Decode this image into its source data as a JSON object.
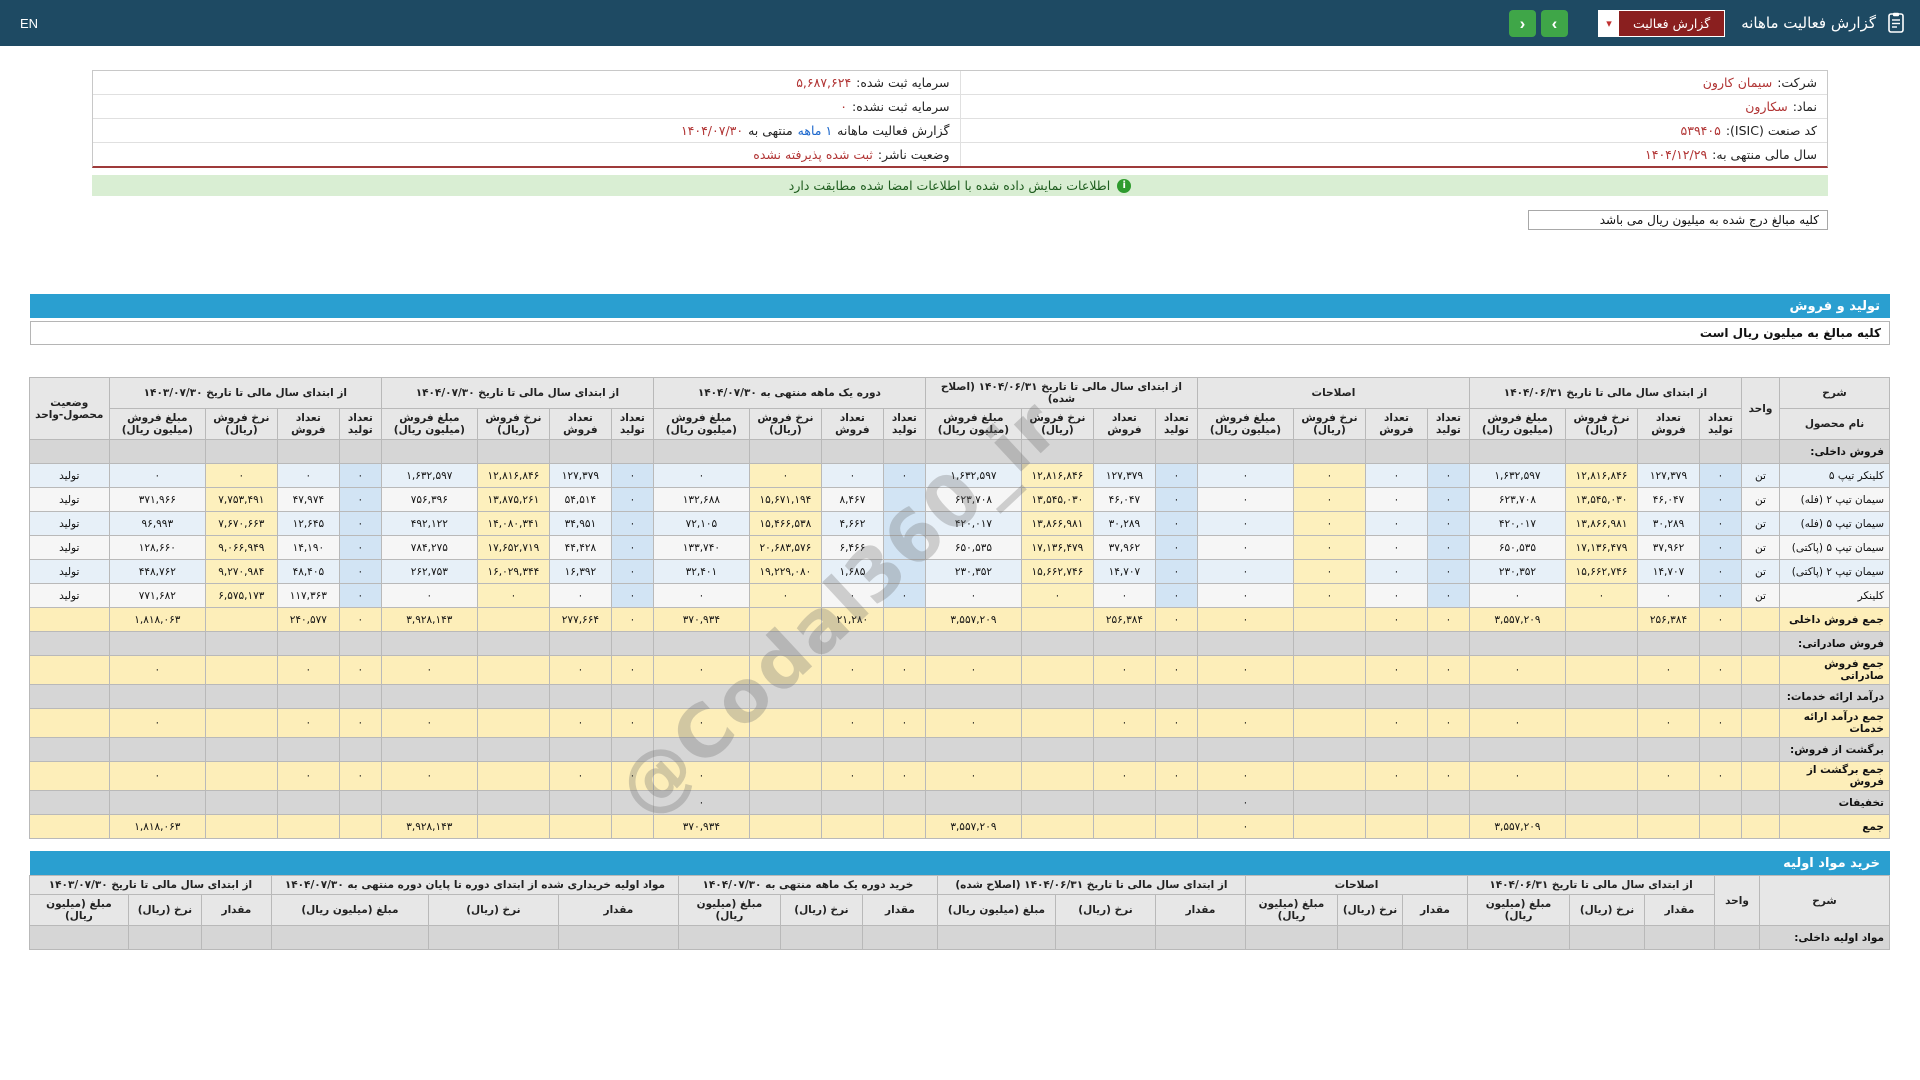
{
  "colors": {
    "topbar_bg": "#1e4a63",
    "section_bar_blue": "#2a9fd0",
    "report_button_red": "#8a1f1f",
    "nav_button_green": "#3fa648",
    "notice_bg_green": "#d9eed3",
    "info_value_red": "#b13434",
    "link_blue": "#1a66cc",
    "cell_yellow": "#fdf0bd",
    "cell_blue": "#d2e4f4"
  },
  "icons": {
    "report_icon": "report-clipboard",
    "chevron_down": "▾",
    "nav_forward": "›",
    "nav_back": "‹",
    "info_icon": "i"
  },
  "topbar": {
    "en_label": "EN",
    "title": "گزارش فعالیت ماهانه",
    "report_button_label": "گزارش فعالیت"
  },
  "company_info": {
    "right": [
      {
        "label": "شرکت:",
        "value": "سیمان کارون"
      },
      {
        "label": "نماد:",
        "value": "سکارون"
      },
      {
        "label": "کد صنعت (ISIC):",
        "value": "۵۳۹۴۰۵"
      },
      {
        "label": "سال مالی منتهی به:",
        "value": "۱۴۰۴/۱۲/۲۹"
      }
    ],
    "left": [
      {
        "label": "سرمایه ثبت شده:",
        "value": "۵,۶۸۷,۶۲۴"
      },
      {
        "label": "سرمایه ثبت نشده:",
        "value": "۰"
      },
      {
        "label": "گزارش فعالیت ماهانه",
        "link": "۱ ماهه",
        "mid": "منتهی به",
        "value": "۱۴۰۴/۰۷/۳۰"
      },
      {
        "label": "وضعیت ناشر:",
        "value": "ثبت شده پذیرفته نشده"
      }
    ]
  },
  "notice_text": "اطلاعات نمایش داده شده با اطلاعات امضا شده مطابقت دارد",
  "amounts_note": "کلیه مبالغ درج شده به میلیون ریال می باشد",
  "watermark": "@Codal360_ir",
  "production_sales": {
    "bar_title": "تولید و فروش",
    "subtitle": "کلیه مبالغ به میلیون ریال است",
    "name_group": "شرح",
    "name_sub": "نام محصول",
    "unit_header": "واحد",
    "status_header": "وضعیت محصول-واحد",
    "sub_cols": [
      "تعداد تولید",
      "تعداد فروش",
      "نرخ فروش (ریال)",
      "مبلغ فروش (میلیون ریال)"
    ],
    "groups": [
      "از ابتدای سال مالی تا تاریخ ۱۴۰۴/۰۶/۳۱",
      "اصلاحات",
      "از ابتدای سال مالی تا تاریخ ۱۴۰۴/۰۶/۳۱ (اصلاح شده)",
      "دوره یک ماهه منتهی به ۱۴۰۴/۰۷/۳۰",
      "از ابتدای سال مالی تا تاریخ ۱۴۰۴/۰۷/۳۰",
      "از ابتدای سال مالی تا تاریخ ۱۴۰۳/۰۷/۳۰"
    ],
    "rows": [
      {
        "t": "section",
        "name": "فروش داخلی:"
      },
      {
        "t": "data",
        "name": "کلینکر تیپ ۵",
        "unit": "تن",
        "status": "تولید",
        "cells": [
          "۰",
          "۱۲۷,۳۷۹",
          "۱۲,۸۱۶,۸۴۶",
          "۱,۶۳۲,۵۹۷",
          "۰",
          "۰",
          "۰",
          "۰",
          "۰",
          "۱۲۷,۳۷۹",
          "۱۲,۸۱۶,۸۴۶",
          "۱,۶۳۲,۵۹۷",
          "۰",
          "۰",
          "۰",
          "۰",
          "۰",
          "۱۲۷,۳۷۹",
          "۱۲,۸۱۶,۸۴۶",
          "۱,۶۳۲,۵۹۷",
          "۰",
          "۰",
          "۰",
          "۰"
        ]
      },
      {
        "t": "data",
        "name": "سیمان تیپ ۲ (فله)",
        "unit": "تن",
        "status": "تولید",
        "cells": [
          "۰",
          "۴۶,۰۴۷",
          "۱۳,۵۴۵,۰۳۰",
          "۶۲۳,۷۰۸",
          "۰",
          "۰",
          "۰",
          "۰",
          "۰",
          "۴۶,۰۴۷",
          "۱۳,۵۴۵,۰۳۰",
          "۶۲۳,۷۰۸",
          "",
          "۸,۴۶۷",
          "۱۵,۶۷۱,۱۹۴",
          "۱۳۲,۶۸۸",
          "۰",
          "۵۴,۵۱۴",
          "۱۳,۸۷۵,۲۶۱",
          "۷۵۶,۳۹۶",
          "۰",
          "۴۷,۹۷۴",
          "۷,۷۵۳,۴۹۱",
          "۳۷۱,۹۶۶"
        ]
      },
      {
        "t": "data",
        "name": "سیمان تیپ ۵ (فله)",
        "unit": "تن",
        "status": "تولید",
        "cells": [
          "۰",
          "۳۰,۲۸۹",
          "۱۳,۸۶۶,۹۸۱",
          "۴۲۰,۰۱۷",
          "۰",
          "۰",
          "۰",
          "۰",
          "۰",
          "۳۰,۲۸۹",
          "۱۳,۸۶۶,۹۸۱",
          "۴۲۰,۰۱۷",
          "",
          "۴,۶۶۲",
          "۱۵,۴۶۶,۵۳۸",
          "۷۲,۱۰۵",
          "۰",
          "۳۴,۹۵۱",
          "۱۴,۰۸۰,۳۴۱",
          "۴۹۲,۱۲۲",
          "۰",
          "۱۲,۶۴۵",
          "۷,۶۷۰,۶۶۳",
          "۹۶,۹۹۳"
        ]
      },
      {
        "t": "data",
        "name": "سیمان تیپ ۵ (پاکتی)",
        "unit": "تن",
        "status": "تولید",
        "cells": [
          "۰",
          "۳۷,۹۶۲",
          "۱۷,۱۳۶,۴۷۹",
          "۶۵۰,۵۳۵",
          "۰",
          "۰",
          "۰",
          "۰",
          "۰",
          "۳۷,۹۶۲",
          "۱۷,۱۳۶,۴۷۹",
          "۶۵۰,۵۳۵",
          "",
          "۶,۴۶۶",
          "۲۰,۶۸۳,۵۷۶",
          "۱۳۳,۷۴۰",
          "۰",
          "۴۴,۴۲۸",
          "۱۷,۶۵۲,۷۱۹",
          "۷۸۴,۲۷۵",
          "۰",
          "۱۴,۱۹۰",
          "۹,۰۶۶,۹۴۹",
          "۱۲۸,۶۶۰"
        ]
      },
      {
        "t": "data",
        "name": "سیمان تیپ ۲ (پاکتی)",
        "unit": "تن",
        "status": "تولید",
        "cells": [
          "۰",
          "۱۴,۷۰۷",
          "۱۵,۶۶۲,۷۴۶",
          "۲۳۰,۳۵۲",
          "۰",
          "۰",
          "۰",
          "۰",
          "۰",
          "۱۴,۷۰۷",
          "۱۵,۶۶۲,۷۴۶",
          "۲۳۰,۳۵۲",
          "",
          "۱,۶۸۵",
          "۱۹,۲۲۹,۰۸۰",
          "۳۲,۴۰۱",
          "۰",
          "۱۶,۳۹۲",
          "۱۶,۰۲۹,۳۴۴",
          "۲۶۲,۷۵۳",
          "۰",
          "۴۸,۴۰۵",
          "۹,۲۷۰,۹۸۴",
          "۴۴۸,۷۶۲"
        ]
      },
      {
        "t": "data",
        "name": "کلینکر",
        "unit": "تن",
        "status": "تولید",
        "cells": [
          "۰",
          "۰",
          "۰",
          "۰",
          "۰",
          "۰",
          "۰",
          "۰",
          "۰",
          "۰",
          "۰",
          "۰",
          "۰",
          "۰",
          "۰",
          "۰",
          "۰",
          "۰",
          "۰",
          "۰",
          "۰",
          "۱۱۷,۳۶۳",
          "۶,۵۷۵,۱۷۳",
          "۷۷۱,۶۸۲"
        ]
      },
      {
        "t": "total",
        "name": "جمع فروش داخلی",
        "cells": [
          "۰",
          "۲۵۶,۳۸۴",
          "",
          "۳,۵۵۷,۲۰۹",
          "۰",
          "۰",
          "",
          "۰",
          "۰",
          "۲۵۶,۳۸۴",
          "",
          "۳,۵۵۷,۲۰۹",
          "",
          "۲۱,۲۸۰",
          "",
          "۳۷۰,۹۳۴",
          "۰",
          "۲۷۷,۶۶۴",
          "",
          "۳,۹۲۸,۱۴۳",
          "۰",
          "۲۴۰,۵۷۷",
          "",
          "۱,۸۱۸,۰۶۳"
        ]
      },
      {
        "t": "section",
        "name": "فروش صادراتی:"
      },
      {
        "t": "total",
        "name": "جمع فروش صادراتی",
        "cells": [
          "۰",
          "۰",
          "",
          "۰",
          "۰",
          "۰",
          "",
          "۰",
          "۰",
          "۰",
          "",
          "۰",
          "۰",
          "۰",
          "",
          "۰",
          "۰",
          "۰",
          "",
          "۰",
          "۰",
          "۰",
          "",
          "۰"
        ]
      },
      {
        "t": "section",
        "name": "درآمد ارائه خدمات:"
      },
      {
        "t": "total",
        "name": "جمع درآمد ارائه خدمات",
        "cells": [
          "۰",
          "۰",
          "",
          "۰",
          "۰",
          "۰",
          "",
          "۰",
          "۰",
          "۰",
          "",
          "۰",
          "۰",
          "۰",
          "",
          "۰",
          "۰",
          "۰",
          "",
          "۰",
          "۰",
          "۰",
          "",
          "۰"
        ]
      },
      {
        "t": "section",
        "name": "برگشت از فروش:"
      },
      {
        "t": "total",
        "name": "جمع برگشت از فروش",
        "cells": [
          "۰",
          "۰",
          "",
          "۰",
          "۰",
          "۰",
          "",
          "۰",
          "۰",
          "۰",
          "",
          "۰",
          "۰",
          "۰",
          "",
          "۰",
          "۰",
          "۰",
          "",
          "۰",
          "۰",
          "۰",
          "",
          "۰"
        ]
      },
      {
        "t": "muted",
        "name": "تخفیفات",
        "cells": [
          "",
          "",
          "",
          "",
          "",
          "",
          "",
          "۰",
          "",
          "",
          "",
          "",
          "",
          "",
          "",
          "۰",
          "",
          "",
          "",
          "",
          "",
          "",
          "",
          ""
        ]
      },
      {
        "t": "total",
        "name": "جمع",
        "cells": [
          "",
          "",
          "",
          "۳,۵۵۷,۲۰۹",
          "",
          "",
          "",
          "۰",
          "",
          "",
          "",
          "۳,۵۵۷,۲۰۹",
          "",
          "",
          "",
          "۳۷۰,۹۳۴",
          "",
          "",
          "",
          "۳,۹۲۸,۱۴۳",
          "",
          "",
          "",
          "۱,۸۱۸,۰۶۳"
        ]
      }
    ]
  },
  "raw_materials": {
    "bar_title": "خرید مواد اولیه",
    "name_group": "شرح",
    "unit_header": "واحد",
    "sub_cols": [
      "مقدار",
      "نرخ (ریال)",
      "مبلغ (میلیون ریال)"
    ],
    "groups": [
      "از ابتدای سال مالی تا تاریخ ۱۴۰۴/۰۶/۳۱",
      "اصلاحات",
      "از ابتدای سال مالی تا تاریخ ۱۴۰۴/۰۶/۳۱ (اصلاح شده)",
      "خرید دوره یک ماهه منتهی به ۱۴۰۴/۰۷/۳۰",
      "مواد اولیه خریداری شده از ابتدای دوره تا پایان دوره منتهی به ۱۴۰۴/۰۷/۳۰",
      "از ابتدای سال مالی تا تاریخ ۱۴۰۳/۰۷/۳۰"
    ],
    "rows": [
      {
        "t": "section",
        "name": "مواد اولیه داخلی:"
      }
    ]
  }
}
